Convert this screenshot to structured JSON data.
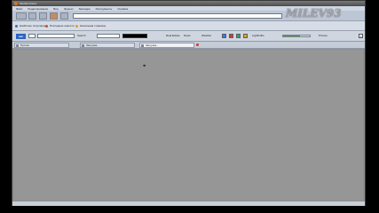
{
  "window": {
    "title": "Mozilla Firefox"
  },
  "menu": {
    "items": [
      "Файл",
      "Редактирование",
      "Вид",
      "Журнал",
      "Закладки",
      "Инструменты",
      "Справка"
    ]
  },
  "bookmarks": {
    "items": [
      {
        "label": "Наиболее популярные",
        "color": "#3a6fb4"
      },
      {
        "label": "Последние новости",
        "color": "#d24a2a"
      },
      {
        "label": "Начальная страница",
        "color": "#e0a020"
      }
    ]
  },
  "ask_toolbar": {
    "logo": "ask",
    "search_button": "Search",
    "page_button": "Real Estate",
    "news_button": "News",
    "weather_label": "Weather",
    "volume_level": 0.62,
    "lightbulb_label": "Lightbulbs",
    "more_label": "Privacy"
  },
  "tabs": [
    {
      "label": "Пустая",
      "active": false
    },
    {
      "label": "Загрузка...",
      "active": false
    },
    {
      "label": "Загрузка...",
      "active": true
    }
  ],
  "watermark": "MILEV93",
  "colors": {
    "content_bg": "#969696",
    "toolbar_bg": "#cfd6e0"
  }
}
